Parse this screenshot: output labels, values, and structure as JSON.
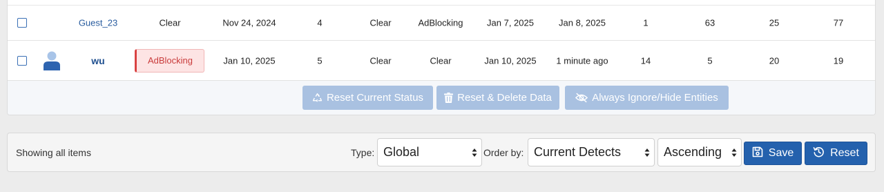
{
  "table": {
    "rows": [
      {
        "user": "Guest_23",
        "status": "Clear",
        "first_seen": "Nov 24, 2024",
        "count": "4",
        "c1": "Clear",
        "c2": "AdBlocking",
        "date1": "Jan 7, 2025",
        "date2": "Jan 8, 2025",
        "n1": "1",
        "n2": "63",
        "n3": "25",
        "n4": "77"
      },
      {
        "user": "wu",
        "status": "AdBlocking",
        "first_seen": "Jan 10, 2025",
        "count": "5",
        "c1": "Clear",
        "c2": "Clear",
        "date1": "Jan 10, 2025",
        "date2": "1 minute ago",
        "n1": "14",
        "n2": "5",
        "n3": "20",
        "n4": "19"
      }
    ]
  },
  "actions": {
    "reset_status": "Reset Current Status",
    "reset_delete": "Reset & Delete Data",
    "ignore_hide": "Always Ignore/Hide Entities"
  },
  "footer": {
    "showing": "Showing all items",
    "type_label": "Type:",
    "type_value": "Global",
    "order_label": "Order by:",
    "order_value": "Current Detects",
    "direction_value": "Ascending",
    "save_label": "Save",
    "reset_label": "Reset"
  },
  "colors": {
    "primary": "#2461ad",
    "disabled_button": "#a9c1e1",
    "link": "#2a5d9f",
    "danger": "#c93b3b"
  },
  "icons": {
    "avatar": "user-avatar-icon",
    "recycle": "recycle-icon",
    "trash": "trash-icon",
    "eye_slash": "eye-slash-icon",
    "floppy": "floppy-disk-icon",
    "history": "history-icon"
  }
}
